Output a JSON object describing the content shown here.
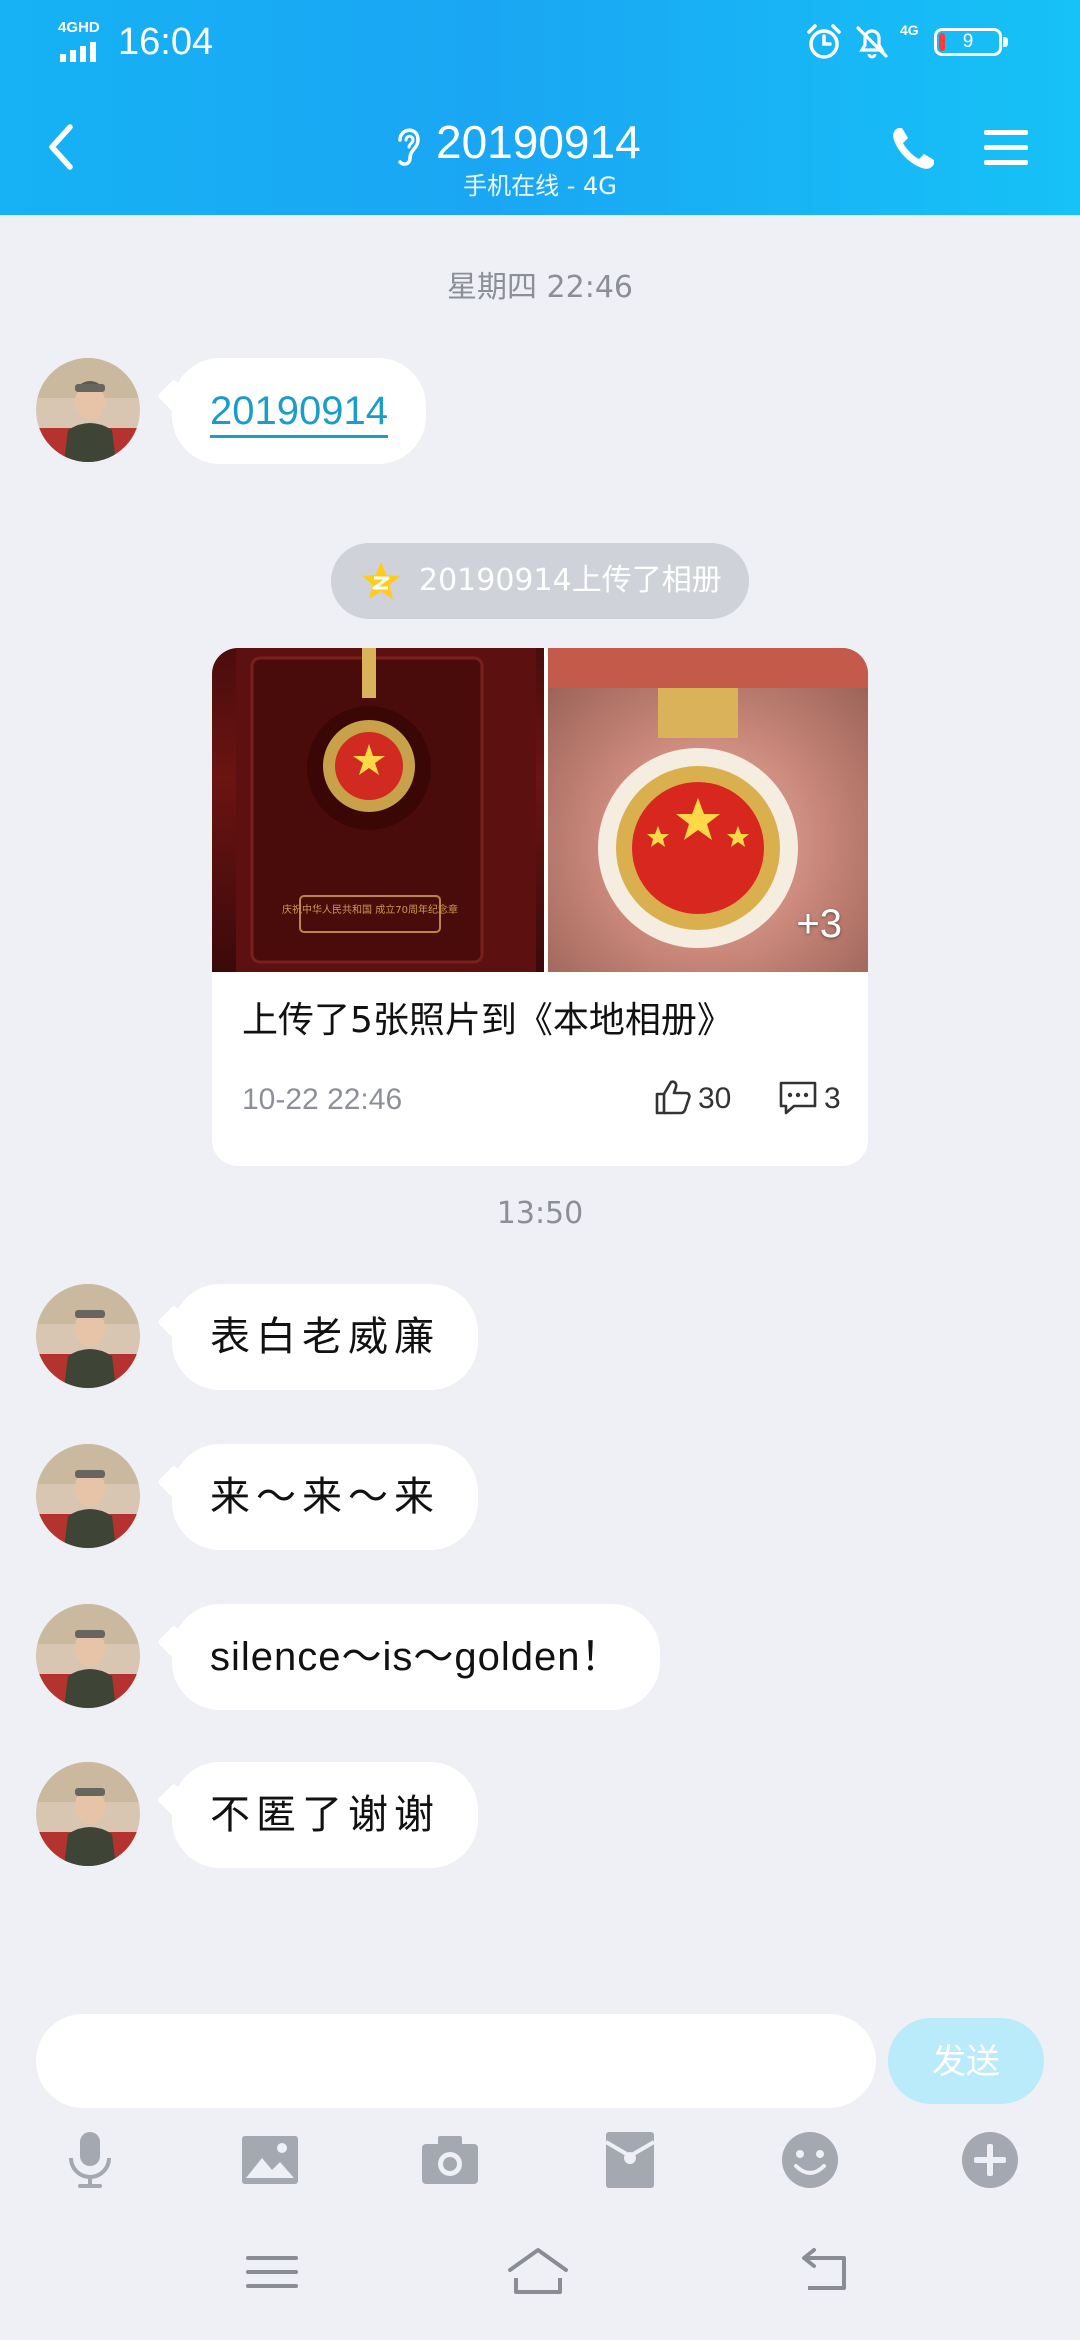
{
  "status_bar": {
    "network": "4GHD",
    "time": "16:04",
    "network_right": "4G",
    "battery": "9"
  },
  "header": {
    "title": "20190914",
    "subtitle": "手机在线 - 4G"
  },
  "chat": {
    "timestamp_1": "星期四 22:46",
    "link_message": "20190914",
    "album_notice": "20190914上传了相册",
    "album": {
      "more_count": "+3",
      "title": "上传了5张照片到《本地相册》",
      "time": "10-22 22:46",
      "likes": "30",
      "comments": "3",
      "photo_1_caption": "庆祝中华人民共和国 成立70周年纪念章"
    },
    "timestamp_2": "13:50",
    "messages": [
      "表白老威廉",
      "来～来～来",
      "silence～is～golden！",
      "不匿了谢谢"
    ]
  },
  "input": {
    "value": "",
    "placeholder": "",
    "send_label": "发送"
  },
  "colors": {
    "header_gradient_start": "#16b2f5",
    "header_gradient_end": "#16c2f7",
    "background": "#eef0f5",
    "link": "#1a9ec9",
    "send_button": "#b9ebfb"
  },
  "icons": {
    "back": "chevron-left-icon",
    "ear": "ear-icon",
    "phone": "phone-icon",
    "menu": "menu-icon",
    "star": "qzone-star-icon",
    "like": "thumbs-up-icon",
    "comment": "comment-icon",
    "toolbar": [
      "microphone-icon",
      "image-icon",
      "camera-icon",
      "red-packet-icon",
      "emoji-icon",
      "plus-icon"
    ],
    "nav": [
      "menu-icon",
      "home-icon",
      "back-icon"
    ]
  }
}
